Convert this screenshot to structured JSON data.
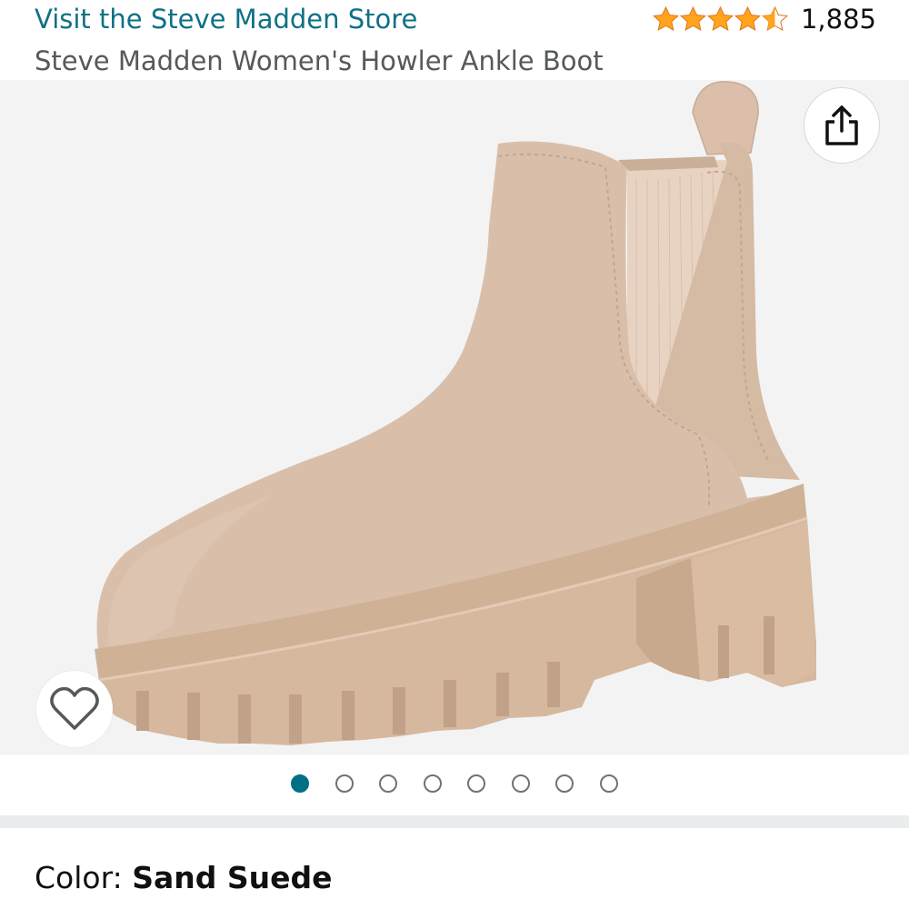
{
  "header": {
    "store_link": "Visit the Steve Madden Store",
    "rating_stars": 4.5,
    "review_count": "1,885",
    "product_title": "Steve Madden Women's Howler Ankle Boot"
  },
  "gallery": {
    "image_subject": "tan suede chelsea ankle boot with lug sole",
    "share_icon": "share-icon",
    "wishlist_icon": "heart-icon",
    "image_count": 8,
    "active_index": 0
  },
  "variation": {
    "color_label": "Color: ",
    "color_value": "Sand Suede"
  },
  "colors": {
    "link": "#0f7185",
    "star": "#ffa41c",
    "accent_dot": "#007185",
    "boot": "#d8bea8",
    "sole": "#d9bca2"
  }
}
